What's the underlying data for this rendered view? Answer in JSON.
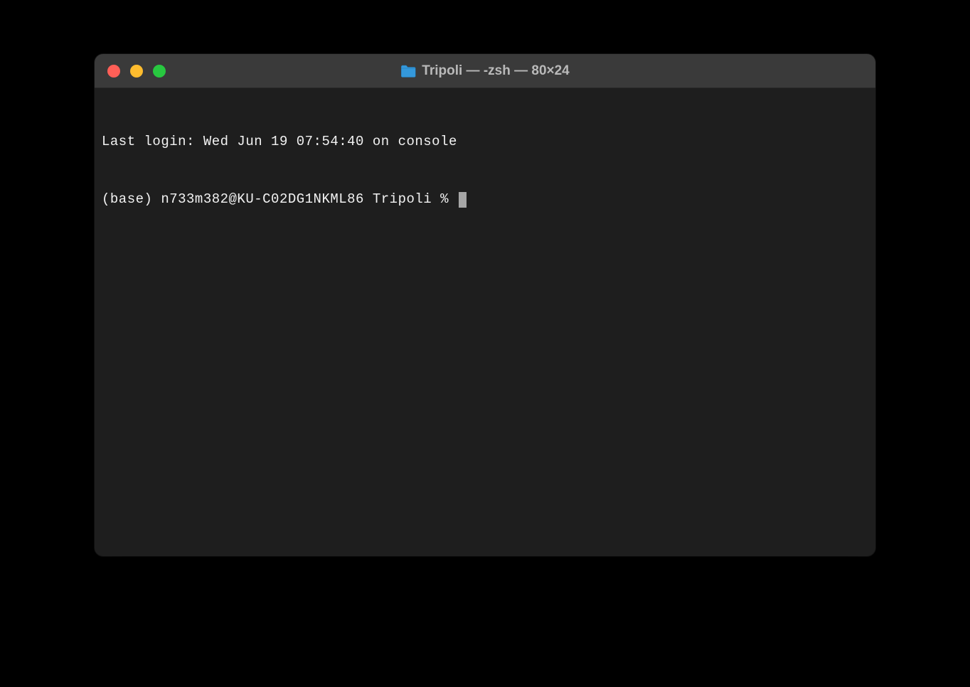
{
  "window": {
    "title": "Tripoli — -zsh — 80×24",
    "folder_icon": "folder-icon"
  },
  "terminal": {
    "last_login_line": "Last login: Wed Jun 19 07:54:40 on console",
    "prompt": "(base) n733m382@KU-C02DG1NKML86 Tripoli % "
  }
}
